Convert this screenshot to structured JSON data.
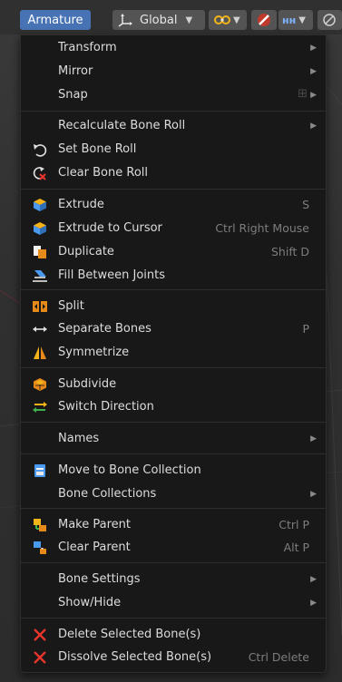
{
  "header": {
    "mode_menu_label": "Armature",
    "orientation_label": "Global"
  },
  "menu": {
    "items": [
      {
        "label": "Transform",
        "shortcut": "",
        "icon": "none",
        "submenu": true
      },
      {
        "label": "Mirror",
        "shortcut": "",
        "icon": "none",
        "submenu": true
      },
      {
        "label": "Snap",
        "shortcut": "",
        "icon": "none",
        "submenu": true
      },
      {
        "label": "Recalculate Bone Roll",
        "shortcut": "",
        "icon": "none",
        "submenu": true
      },
      {
        "label": "Set Bone Roll",
        "shortcut": "",
        "icon": "roll-icon",
        "submenu": false
      },
      {
        "label": "Clear Bone Roll",
        "shortcut": "",
        "icon": "clear-roll-icon",
        "submenu": false
      },
      {
        "label": "Extrude",
        "shortcut": "S",
        "icon": "extrude-icon",
        "submenu": false
      },
      {
        "label": "Extrude to Cursor",
        "shortcut": "Ctrl Right Mouse",
        "icon": "extrude-icon",
        "submenu": false
      },
      {
        "label": "Duplicate",
        "shortcut": "Shift D",
        "icon": "duplicate-icon",
        "submenu": false
      },
      {
        "label": "Fill Between Joints",
        "shortcut": "",
        "icon": "fill-icon",
        "submenu": false
      },
      {
        "label": "Split",
        "shortcut": "",
        "icon": "split-icon",
        "submenu": false
      },
      {
        "label": "Separate Bones",
        "shortcut": "P",
        "icon": "separate-icon",
        "submenu": false
      },
      {
        "label": "Symmetrize",
        "shortcut": "",
        "icon": "symmetrize-icon",
        "submenu": false
      },
      {
        "label": "Subdivide",
        "shortcut": "",
        "icon": "subdivide-icon",
        "submenu": false
      },
      {
        "label": "Switch Direction",
        "shortcut": "",
        "icon": "switch-direction-icon",
        "submenu": false
      },
      {
        "label": "Names",
        "shortcut": "",
        "icon": "none",
        "submenu": true
      },
      {
        "label": "Move to Bone Collection",
        "shortcut": "",
        "icon": "bone-collection-icon",
        "submenu": false
      },
      {
        "label": "Bone Collections",
        "shortcut": "",
        "icon": "none",
        "submenu": true
      },
      {
        "label": "Make Parent",
        "shortcut": "Ctrl P",
        "icon": "make-parent-icon",
        "submenu": false
      },
      {
        "label": "Clear Parent",
        "shortcut": "Alt P",
        "icon": "clear-parent-icon",
        "submenu": false
      },
      {
        "label": "Bone Settings",
        "shortcut": "",
        "icon": "none",
        "submenu": true
      },
      {
        "label": "Show/Hide",
        "shortcut": "",
        "icon": "none",
        "submenu": true
      },
      {
        "label": "Delete Selected Bone(s)",
        "shortcut": "",
        "icon": "delete-x-icon",
        "submenu": false
      },
      {
        "label": "Dissolve Selected Bone(s)",
        "shortcut": "Ctrl Delete",
        "icon": "delete-x-icon",
        "submenu": false
      }
    ]
  },
  "colors": {
    "accent": "#4772b3",
    "menu_bg": "#181818",
    "delete_red": "#e8352c",
    "icon_yellow": "#f2b418",
    "icon_orange": "#e88a1a",
    "icon_blue": "#4a9af0"
  }
}
